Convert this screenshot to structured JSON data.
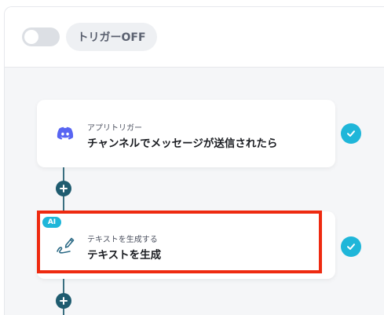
{
  "header": {
    "toggle_state": "off",
    "trigger_label": "トリガーOFF"
  },
  "steps": [
    {
      "sub_label": "アプリトリガー",
      "title": "チャンネルでメッセージが送信されたら",
      "icon": "discord-icon",
      "status": "completed"
    },
    {
      "badge": "AI",
      "sub_label": "テキストを生成する",
      "title": "テキストを生成",
      "icon": "pen-icon",
      "status": "completed",
      "highlighted": true
    }
  ],
  "colors": {
    "accent": "#1fb6d9",
    "connector": "#1f5c70",
    "highlight": "#ee2a10",
    "discord": "#5865f2"
  }
}
